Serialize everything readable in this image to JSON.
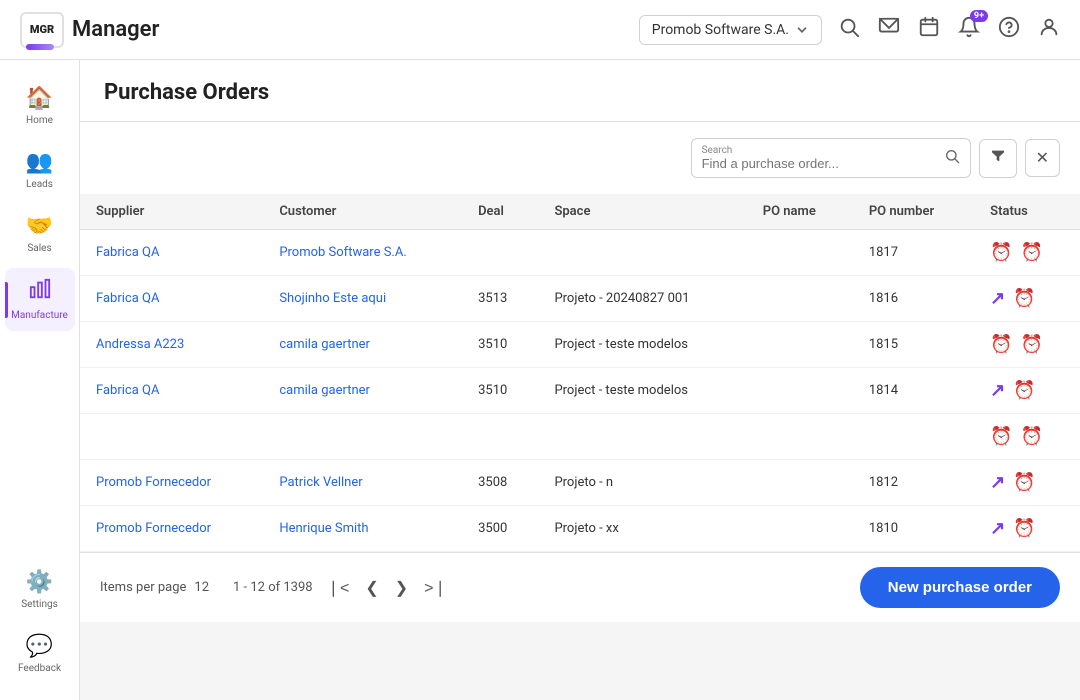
{
  "app": {
    "logo_text": "MGR",
    "title": "Manager"
  },
  "topbar": {
    "company": "Promob Software S.A.",
    "company_dropdown_label": "Promob Software S.A.",
    "notification_badge": "9+"
  },
  "sidebar": {
    "items": [
      {
        "id": "home",
        "label": "Home",
        "icon": "🏠",
        "active": false
      },
      {
        "id": "leads",
        "label": "Leads",
        "icon": "👥",
        "active": false
      },
      {
        "id": "sales",
        "label": "Sales",
        "icon": "🤝",
        "active": false
      },
      {
        "id": "manufacture",
        "label": "Manufacture",
        "icon": "📊",
        "active": true
      },
      {
        "id": "settings",
        "label": "Settings",
        "icon": "⚙️",
        "active": false
      },
      {
        "id": "feedback",
        "label": "Feedback",
        "icon": "💬",
        "active": false
      }
    ]
  },
  "page": {
    "title": "Purchase Orders"
  },
  "search": {
    "label": "Search",
    "placeholder": "Find a purchase order...",
    "filter_icon": "▼",
    "close_icon": "✕"
  },
  "table": {
    "columns": [
      "Supplier",
      "Customer",
      "Deal",
      "Space",
      "PO name",
      "PO number",
      "Status"
    ],
    "rows": [
      {
        "supplier": "Fabrica QA",
        "customer": "Promob Software S.A.",
        "deal": "",
        "space": "",
        "po_name": "",
        "po_number": "1817",
        "status_icons": [
          "clock",
          "clock"
        ]
      },
      {
        "supplier": "Fabrica QA",
        "customer": "Shojinho Este aqui",
        "deal": "3513",
        "space": "Projeto - 20240827 001",
        "po_name": "",
        "po_number": "1816",
        "status_icons": [
          "arrow",
          "clock"
        ]
      },
      {
        "supplier": "Andressa A223",
        "customer": "camila gaertner",
        "deal": "3510",
        "space": "Project - teste modelos",
        "po_name": "",
        "po_number": "1815",
        "status_icons": [
          "clock",
          "clock"
        ]
      },
      {
        "supplier": "Fabrica QA",
        "customer": "camila gaertner",
        "deal": "3510",
        "space": "Project - teste modelos",
        "po_name": "",
        "po_number": "1814",
        "status_icons": [
          "arrow",
          "clock"
        ]
      },
      {
        "supplier": "",
        "customer": "",
        "deal": "",
        "space": "",
        "po_name": "",
        "po_number": "",
        "status_icons": [
          "clock",
          "clock"
        ]
      },
      {
        "supplier": "Promob Fornecedor",
        "customer": "Patrick Vellner",
        "deal": "3508",
        "space": "Projeto - n",
        "po_name": "",
        "po_number": "1812",
        "status_icons": [
          "arrow",
          "clock"
        ]
      },
      {
        "supplier": "Promob Fornecedor",
        "customer": "Henrique Smith",
        "deal": "3500",
        "space": "Projeto - xx",
        "po_name": "",
        "po_number": "1810",
        "status_icons": [
          "arrow",
          "clock-purple"
        ]
      }
    ]
  },
  "footer": {
    "items_per_page_label": "Items per page",
    "items_per_page": "12",
    "range": "1 - 12 of 1398",
    "new_order_btn": "New purchase order"
  }
}
